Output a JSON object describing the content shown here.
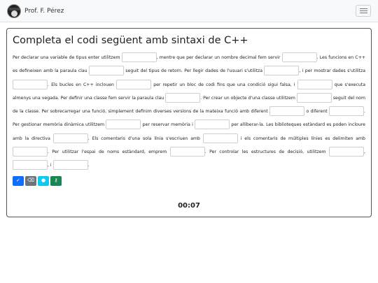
{
  "navbar": {
    "brand": "Prof. F. Pérez",
    "logo_icon": "professor-avatar-icon",
    "menu_icon": "hamburger-menu-icon"
  },
  "title": "Completa el codi següent amb sintaxi de C++",
  "segments": [
    "Per declarar una variable de tipus enter utilitzem",
    ", mentre que per declarar un nombre decimal fem servir",
    ". Les funcions en C++ es defineixen amb la paraula clau",
    "seguit del tipus de retorn. Per llegir dades de l'usuari s'utilitza",
    ", i per mostrar dades s'utilitza",
    ". Els bucles en C++ inclouen",
    "per repetir un bloc de codi fins que una condició sigui falsa, i",
    "que s'executa almenys una vegada. Per definir una classe fem servir la paraula clau",
    ". Per crear un objecte d'una classe utilitzem",
    "seguit del nom de la classe. Per sobrecarregar una funció, simplement definim diverses versions de la mateixa funció amb diferent",
    "o diferent",
    ". Per gestionar memòria dinàmica utilitzem",
    "per reservar memòria i",
    "per alliberar-la. Les biblioteques estàndard es poden incloure amb la directiva",
    ". Els comentaris d'una sola línia s'escriuen amb",
    "i els comentaris de múltiples línies es delimiten amb",
    ". Per utilitzar l'espai de noms estàndard, emprem",
    ". Per controlar les estructures de decisió, utilitzem",
    ",",
    ", i",
    "."
  ],
  "toolbar": [
    {
      "name": "check-button",
      "icon": "check-icon",
      "glyph": "✓"
    },
    {
      "name": "clear-button",
      "icon": "eraser-icon",
      "glyph": "⌫"
    },
    {
      "name": "hint-button",
      "icon": "lightbulb-icon",
      "glyph": "●"
    },
    {
      "name": "solution-button",
      "icon": "key-icon",
      "glyph": "⚷"
    }
  ],
  "timer": "00:07",
  "colors": {
    "check": "#0d6efd",
    "clear": "#6c757d",
    "hint": "#0dcaf0",
    "solution": "#198754"
  }
}
